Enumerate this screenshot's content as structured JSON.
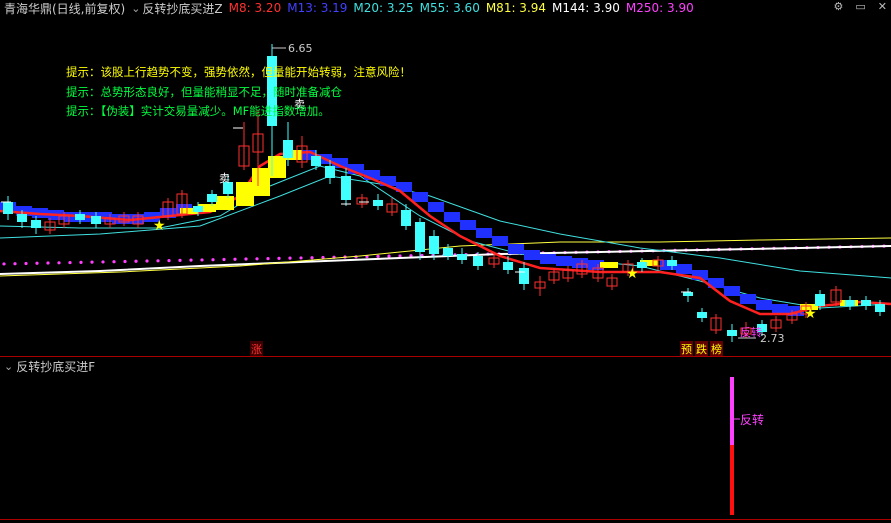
{
  "main_panel": {
    "title": "青海华鼎(日线,前复权)",
    "indicator_name": "反转抄底买进Z",
    "ma": [
      {
        "label": "M8: 3.20",
        "color": "#ff3030"
      },
      {
        "label": "M13: 3.19",
        "color": "#4040ff"
      },
      {
        "label": "M20: 3.25",
        "color": "#40e0e0"
      },
      {
        "label": "M55: 3.60",
        "color": "#40e0e0"
      },
      {
        "label": "M81: 3.94",
        "color": "#ffff40"
      },
      {
        "label": "M144: 3.90",
        "color": "#ffffff"
      },
      {
        "label": "M250: 3.90",
        "color": "#ff40ff"
      }
    ],
    "hints": [
      {
        "text": "提示：该股上行趋势不变，强势依然，但量能开始转弱，注意风险！",
        "color": "#ffff00"
      },
      {
        "text": "提示：总势形态良好，但量能稍显不足，随时准备减仓",
        "color": "#00ff40"
      },
      {
        "text": "提示：【伪装】实计交易量减少。MF能进指数增加。",
        "color": "#00ff40"
      }
    ],
    "high_label": "6.65",
    "low_label": "2.73",
    "sell_label": "卖",
    "sell_label2": "卖",
    "bottom_tags": [
      {
        "text": "涨",
        "color": "#ff3030",
        "bg": "#400000"
      },
      {
        "text": "预",
        "color": "#ffff00",
        "bg": "#600000"
      },
      {
        "text": "跌",
        "color": "#ffff00",
        "bg": "#600000"
      },
      {
        "text": "榜",
        "color": "#ffff00",
        "bg": "#600000"
      }
    ],
    "hidden_label": "反转"
  },
  "sub_panel": {
    "indicator_name": "反转抄底买进F",
    "signal_label": "反转",
    "signal_color": "#ff40ff"
  },
  "window_icons": [
    "gear-icon",
    "minimize-icon",
    "close-icon"
  ],
  "window_glyphs": {
    "gear": "⚙",
    "minimize": "▭",
    "close": "✕"
  },
  "chevron_glyph": "⌄"
}
